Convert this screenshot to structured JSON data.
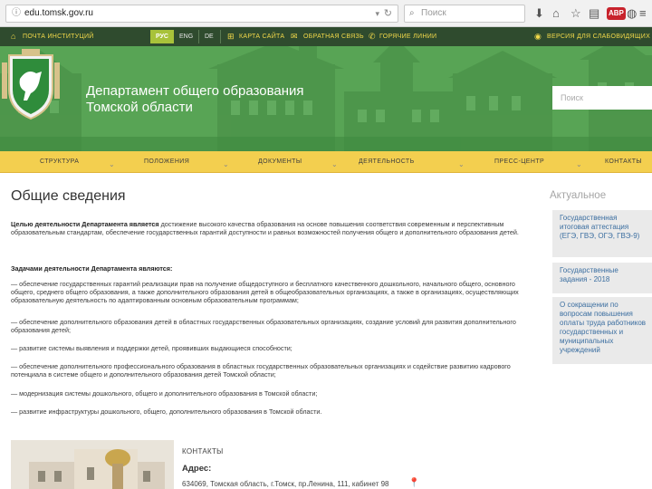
{
  "browser": {
    "url": "edu.tomsk.gov.ru",
    "search_placeholder": "Поиск"
  },
  "topbar": {
    "feedback_mail": "ПОЧТА ИНСТИТУЦИЙ",
    "lang_active": "РУС",
    "lang_en": "ENG",
    "lang_de": "DE",
    "sitemap": "КАРТА САЙТА",
    "feedback": "ОБРАТНАЯ СВЯЗЬ",
    "hotline": "ГОРЯЧИЕ ЛИНИИ",
    "accessibility": "ВЕРСИЯ ДЛЯ СЛАБОВИДЯЩИХ"
  },
  "header": {
    "title_line1": "Департамент общего образования",
    "title_line2": "Томской области",
    "search_placeholder": "Поиск"
  },
  "nav": {
    "items": [
      "СТРУКТУРА",
      "ПОЛОЖЕНИЯ",
      "ДОКУМЕНТЫ",
      "ДЕЯТЕЛЬНОСТЬ",
      "ПРЕСС-ЦЕНТР",
      "КОНТАКТЫ"
    ]
  },
  "main": {
    "title": "Общие сведения",
    "goal_lead": "Целью деятельности Департамента является",
    "goal_text": " достижение высокого качества образования на основе повышения соответствия современным и перспективным образовательным стандартам, обеспечение государственных гарантий доступности и равных возможностей получения общего и дополнительного образования детей.",
    "tasks_heading": "Задачами деятельности Департамента являются:",
    "tasks": [
      "— обеспечение государственных гарантий реализации прав на получение общедоступного и бесплатного качественного дошкольного, начального общего, основного общего, среднего общего образования, а также дополнительного образования детей в общеобразовательных организациях, а также в организациях, осуществляющих образовательную деятельность по адаптированным основным образовательным программам;",
      "— обеспечение дополнительного образования детей в областных государственных образовательных организациях, создание условий для развития дополнительного образования детей;",
      "— развитие системы выявления и поддержки детей, проявивших выдающиеся способности;",
      "— обеспечение дополнительного профессионального образования в областных государственных образовательных организациях и содействие развитию кадрового потенциала в системе общего и дополнительного образования детей Томской области;",
      "— модернизация системы дошкольного, общего и дополнительного образования в Томской области;",
      "— развитие инфраструктуры дошкольного, общего, дополнительного образования в Томской области."
    ]
  },
  "sidebar": {
    "title": "Актуальное",
    "cards": [
      "Государственная итоговая аттестация (ЕГЭ, ГВЭ, ОГЭ, ГВЭ-9)",
      "Государственные задания - 2018",
      "О сокращении по вопросам повышения оплаты труда работников государственных и муниципальных учреждений"
    ]
  },
  "contacts": {
    "label": "КОНТАКТЫ",
    "address_label": "Адрес:",
    "address_text": "634069, Томская область, г.Томск, пр.Ленина, 111, кабинет 98"
  },
  "colors": {
    "topbar": "#2f4b2e",
    "header_green": "#58a455",
    "nav_yellow": "#f3cf4f",
    "accent_lime": "#a8c23a"
  }
}
